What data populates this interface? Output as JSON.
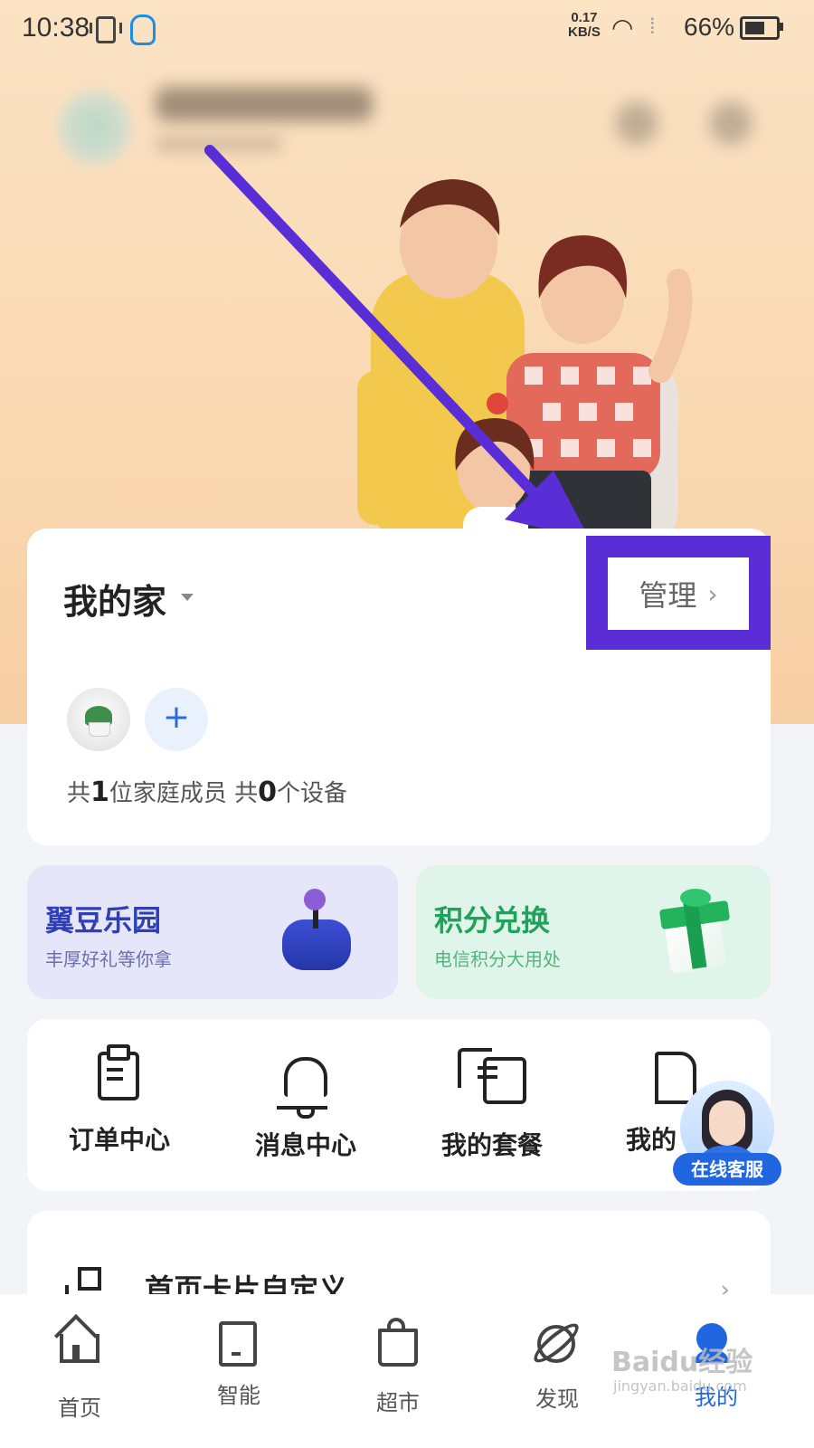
{
  "status_bar": {
    "time": "10:38",
    "net_speed_value": "0.17",
    "net_speed_unit": "KB/S",
    "battery": "66%",
    "battery_level": 0.66
  },
  "home": {
    "title": "我的家",
    "manage_label": "管理",
    "stats_prefix": "共",
    "member_count": "1",
    "member_suffix": "位家庭成员 共",
    "device_count": "0",
    "device_suffix": "个设备"
  },
  "promos": [
    {
      "title": "翼豆乐园",
      "subtitle": "丰厚好礼等你拿",
      "title_color": "#2f3fb5",
      "subtitle_color": "#6a6fae"
    },
    {
      "title": "积分兑换",
      "subtitle": "电信积分大用处",
      "title_color": "#1fa35a",
      "subtitle_color": "#55b47e"
    }
  ],
  "menu": [
    {
      "label": "订单中心",
      "icon": "clipboard-icon"
    },
    {
      "label": "消息中心",
      "icon": "bell-icon"
    },
    {
      "label": "我的套餐",
      "icon": "plan-icon"
    },
    {
      "label": "我的",
      "icon": "building-icon"
    }
  ],
  "service": {
    "label": "在线客服"
  },
  "custom_card": {
    "label": "首页卡片自定义"
  },
  "tabs": [
    {
      "label": "首页",
      "icon": "home-icon"
    },
    {
      "label": "智能",
      "icon": "tablet-icon"
    },
    {
      "label": "超市",
      "icon": "shopping-bag-icon"
    },
    {
      "label": "发现",
      "icon": "planet-icon"
    },
    {
      "label": "我的",
      "icon": "profile-icon",
      "active": true
    }
  ],
  "watermark": {
    "text": "Baidu经验",
    "sub": "jingyan.baidu.com"
  },
  "colors": {
    "accent": "#1f66e0",
    "highlight": "#5b2dd6"
  }
}
